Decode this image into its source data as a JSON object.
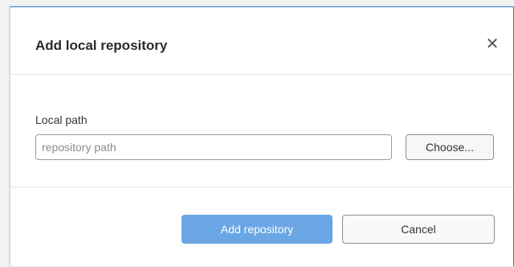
{
  "dialog": {
    "title": "Add local repository",
    "close_icon": "close-icon",
    "close_glyph": "✕"
  },
  "form": {
    "path_label": "Local path",
    "path_value": "",
    "path_placeholder": "repository path",
    "choose_label": "Choose..."
  },
  "footer": {
    "primary_label": "Add repository",
    "cancel_label": "Cancel"
  },
  "colors": {
    "accent": "#2f7fd6",
    "primary_button": "#6aa6e4"
  }
}
